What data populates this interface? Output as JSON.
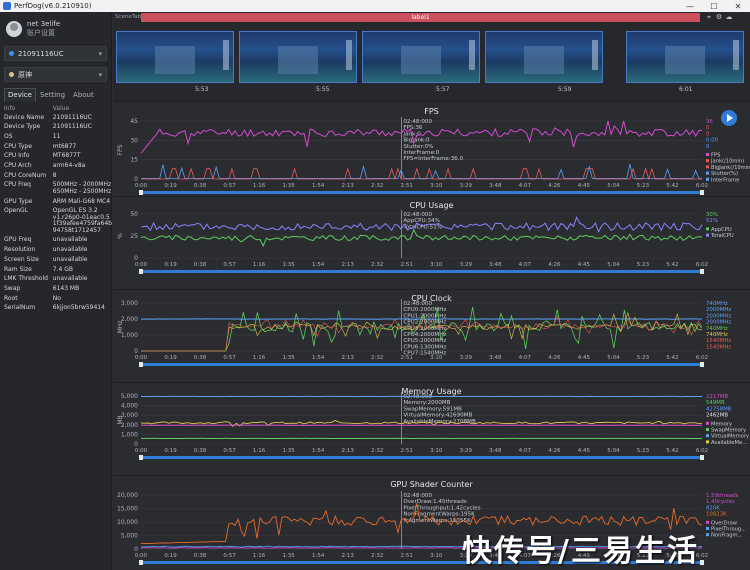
{
  "window": {
    "title": "PerfDog(v6.0.210910)"
  },
  "user": {
    "name": "net 3elife",
    "status_icon": "circle-icon",
    "sub": "账户设置"
  },
  "device_select": {
    "value": "21091116UC"
  },
  "app_select": {
    "value": "原神"
  },
  "tabs": [
    "Device",
    "Setting",
    "About"
  ],
  "info": {
    "headers": [
      "Info",
      "Value"
    ],
    "rows": [
      [
        "Device Name",
        "21091116UC"
      ],
      [
        "Device Type",
        "21091116UC"
      ],
      [
        "OS",
        "11"
      ],
      [
        "CPU Type",
        "mt6877"
      ],
      [
        "CPU Info",
        "MT6877T"
      ],
      [
        "CPU Arch",
        "arm64-v8a"
      ],
      [
        "CPU CoreNum",
        "8"
      ],
      [
        "CPU Freq",
        "500MHz - 2000MHz\n650MHz - 2500MHz"
      ],
      [
        "GPU Type",
        "ARM Mali-G68 MC4"
      ],
      [
        "OpenGL",
        "OpenGL ES 3.2\nv1.r26p0-01eac0.5\n1f39afee4759fa64b\n94758t1712457"
      ],
      [
        "GPU Freq",
        "unavailable"
      ],
      [
        "Resolution",
        "unavailable"
      ],
      [
        "Screen Size",
        "unavailable"
      ],
      [
        "Ram Size",
        "7.4 GB"
      ],
      [
        "LMK Threshold",
        "unavailable"
      ],
      [
        "Swap",
        "6143 MB"
      ],
      [
        "Root",
        "No"
      ],
      [
        "SerialNum",
        "6kjjon5brw59414"
      ]
    ]
  },
  "scene": {
    "tab_label": "SceneTab",
    "label": "label1",
    "times": [
      "5:53",
      "5:55",
      "5:57",
      "5:59",
      "6:01"
    ]
  },
  "time_axis": [
    "0:00",
    "0:19",
    "0:38",
    "0:57",
    "1:16",
    "1:35",
    "1:54",
    "2:13",
    "2:32",
    "2:51",
    "3:10",
    "3:29",
    "3:48",
    "4:07",
    "4:26",
    "4:45",
    "5:04",
    "5:23",
    "5:42",
    "6:02"
  ],
  "panels": {
    "fps": {
      "title": "FPS",
      "ylabel": "FPS",
      "yticks": [
        "45",
        "30",
        "15",
        "0"
      ],
      "tooltip": [
        "02:48:000",
        "FPS:36",
        "Jank:0",
        "BigJank:0",
        "Stutter:0%",
        "InterFrame:0",
        "FPS=InterFrame:36.0"
      ],
      "legend_values": [
        {
          "text": "36",
          "color": "#d34bd0"
        },
        {
          "text": "0",
          "color": "#e85a5a"
        },
        {
          "text": "0",
          "color": "#e85a5a"
        },
        {
          "text": "0.00",
          "color": "#5aa0ff"
        },
        {
          "text": "0",
          "color": "#5aa0ff"
        }
      ],
      "legend": [
        {
          "text": "FPS",
          "color": "#d34bd0"
        },
        {
          "text": "Jank(/10min)",
          "color": "#e85a5a"
        },
        {
          "text": "BigJank(/10min)",
          "color": "#e85a5a"
        },
        {
          "text": "Stutter(%)",
          "color": "#5aa0ff"
        },
        {
          "text": "InterFrame",
          "color": "#5aa0ff"
        }
      ]
    },
    "cpu": {
      "title": "CPU Usage",
      "ylabel": "%",
      "yticks": [
        "50",
        "25",
        "0"
      ],
      "tooltip": [
        "02:48:000",
        "AppCPU:34%",
        "TotalCPU:51%"
      ],
      "legend_values": [
        {
          "text": "30%",
          "color": "#5ccc5c"
        },
        {
          "text": "51%",
          "color": "#8a82ff"
        }
      ],
      "legend": [
        {
          "text": "AppCPU",
          "color": "#5ccc5c"
        },
        {
          "text": "TotalCPU",
          "color": "#8a82ff"
        }
      ]
    },
    "clock": {
      "title": "CPU Clock",
      "ylabel": "MHz",
      "yticks": [
        "3,000",
        "2,000",
        "1,000",
        "0"
      ],
      "tooltip": [
        "02:48:000",
        "CPU0:2000MHz",
        "CPU1:2000MHz",
        "CPU2:2000MHz",
        "CPU3:2000MHz",
        "CPU4:2000MHz",
        "CPU5:2000MHz",
        "CPU6:1300MHz",
        "CPU7:1540MHz"
      ],
      "legend_values": [
        {
          "text": "740MHz",
          "color": "#5aa0ff"
        },
        {
          "text": "2000MHz",
          "color": "#5aa0ff"
        },
        {
          "text": "2000MHz",
          "color": "#5aa0ff"
        },
        {
          "text": "2000MHz",
          "color": "#5aa0ff"
        },
        {
          "text": "740MHz",
          "color": "#5ccc5c"
        },
        {
          "text": "740MHz",
          "color": "#e6c84a"
        },
        {
          "text": "1540MHz",
          "color": "#e85a5a"
        },
        {
          "text": "1540MHz",
          "color": "#e85a5a"
        }
      ]
    },
    "memory": {
      "title": "Memory Usage",
      "ylabel": "MB",
      "yticks": [
        "5,000",
        "4,000",
        "3,000",
        "2,000",
        "1,000",
        "0"
      ],
      "tooltip": [
        "02:48:000",
        "Memory:2000MB",
        "SwapMemory:591MB",
        "VirtualMemory:42690MB",
        "AvailableMemory:2708MB"
      ],
      "legend_values": [
        {
          "text": "2217MB",
          "color": "#d34bd0"
        },
        {
          "text": "549MB",
          "color": "#5ccc5c"
        },
        {
          "text": "42758MB",
          "color": "#5aa0ff"
        },
        {
          "text": "2462MB",
          "color": "#e6e8ec"
        }
      ],
      "legend": [
        {
          "text": "Memory",
          "color": "#d34bd0"
        },
        {
          "text": "SwapMemory",
          "color": "#5ccc5c"
        },
        {
          "text": "VirtualMemory",
          "color": "#5aa0ff"
        },
        {
          "text": "AvailableMe...",
          "color": "#e6c84a"
        }
      ]
    },
    "shader": {
      "title": "GPU Shader Counter",
      "yticks": [
        "20,000",
        "15,000",
        "10,000",
        "5,000",
        "0"
      ],
      "tooltip": [
        "02:48:000",
        "OverDraw:1.45threads",
        "PixelThroughput:1.42cycles",
        "NonFragmentWarps:195K",
        "FragmentWarps:11055K"
      ],
      "legend_values": [
        {
          "text": "1.59threads",
          "color": "#d34bd0"
        },
        {
          "text": "1.40cycles",
          "color": "#d34bd0"
        },
        {
          "text": "820K",
          "color": "#5aa0ff"
        },
        {
          "text": "10823K",
          "color": "#e86a2a"
        }
      ],
      "legend": [
        {
          "text": "OverDraw",
          "color": "#d34bd0"
        },
        {
          "text": "PixelThroug...",
          "color": "#5aa0ff"
        },
        {
          "text": "NonFragm...",
          "color": "#5aa0ff"
        }
      ]
    }
  },
  "watermark": "快传号/三易生活"
}
